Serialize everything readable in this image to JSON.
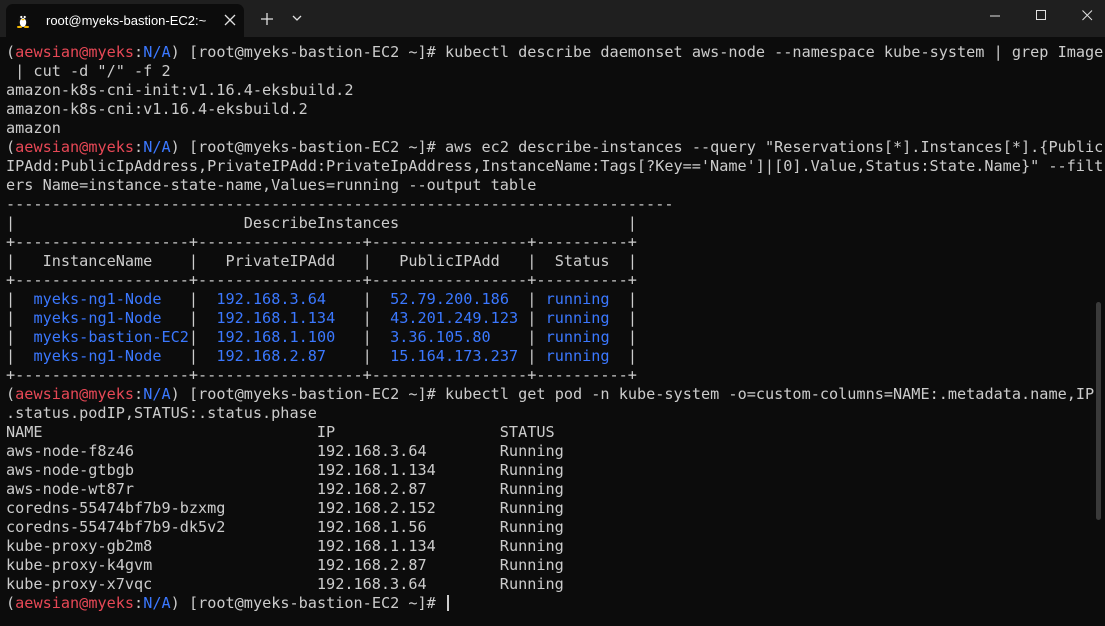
{
  "window": {
    "tab_title": "root@myeks-bastion-EC2:~",
    "tab_icon": "linux-tux-icon",
    "colors": {
      "prompt_user": "#e74856",
      "prompt_env": "#3b78ff",
      "table_data": "#3b78ff",
      "text": "#cccccc",
      "background": "#0c0c0c"
    }
  },
  "prompt": {
    "user": "aewsian",
    "at": "@",
    "host": "myeks",
    "sep": ":",
    "env": "N/A",
    "rest": " [root@myeks-bastion-EC2 ~]# "
  },
  "commands": {
    "cmd1_line1": "kubectl describe daemonset aws-node --namespace kube-system | grep Image",
    "cmd1_line2": " | cut -d \"/\" -f 2",
    "cmd2_line1": "aws ec2 describe-instances --query \"Reservations[*].Instances[*].{Public",
    "cmd2_line2": "IPAdd:PublicIpAddress,PrivateIPAdd:PrivateIpAddress,InstanceName:Tags[?Key=='Name']|[0].Value,Status:State.Name}\" --filt",
    "cmd2_line3": "ers Name=instance-state-name,Values=running --output table",
    "cmd3_line1": "kubectl get pod -n kube-system -o=custom-columns=NAME:.metadata.name,IP:",
    "cmd3_line2": ".status.podIP,STATUS:.status.phase"
  },
  "image_output": [
    "amazon-k8s-cni-init:v1.16.4-eksbuild.2",
    "amazon-k8s-cni:v1.16.4-eksbuild.2",
    "amazon"
  ],
  "instances_table": {
    "title": "DescribeInstances",
    "border": "-------------------------------------------------------------------------",
    "sep": "+-------------------+------------------+-----------------+----------+",
    "headers": [
      "InstanceName",
      "PrivateIPAdd",
      "PublicIPAdd",
      "Status"
    ],
    "rows": [
      {
        "name": "myeks-ng1-Node",
        "private": "192.168.3.64",
        "public": "52.79.200.186",
        "status": "running"
      },
      {
        "name": "myeks-ng1-Node",
        "private": "192.168.1.134",
        "public": "43.201.249.123",
        "status": "running"
      },
      {
        "name": "myeks-bastion-EC2",
        "private": "192.168.1.100",
        "public": "3.36.105.80",
        "status": "running"
      },
      {
        "name": "myeks-ng1-Node",
        "private": "192.168.2.87",
        "public": "15.164.173.237",
        "status": "running"
      }
    ]
  },
  "pods_table": {
    "headers": [
      "NAME",
      "IP",
      "STATUS"
    ],
    "rows": [
      {
        "name": "aws-node-f8z46",
        "ip": "192.168.3.64",
        "status": "Running"
      },
      {
        "name": "aws-node-gtbgb",
        "ip": "192.168.1.134",
        "status": "Running"
      },
      {
        "name": "aws-node-wt87r",
        "ip": "192.168.2.87",
        "status": "Running"
      },
      {
        "name": "coredns-55474bf7b9-bzxmg",
        "ip": "192.168.2.152",
        "status": "Running"
      },
      {
        "name": "coredns-55474bf7b9-dk5v2",
        "ip": "192.168.1.56",
        "status": "Running"
      },
      {
        "name": "kube-proxy-gb2m8",
        "ip": "192.168.1.134",
        "status": "Running"
      },
      {
        "name": "kube-proxy-k4gvm",
        "ip": "192.168.2.87",
        "status": "Running"
      },
      {
        "name": "kube-proxy-x7vqc",
        "ip": "192.168.3.64",
        "status": "Running"
      }
    ]
  }
}
